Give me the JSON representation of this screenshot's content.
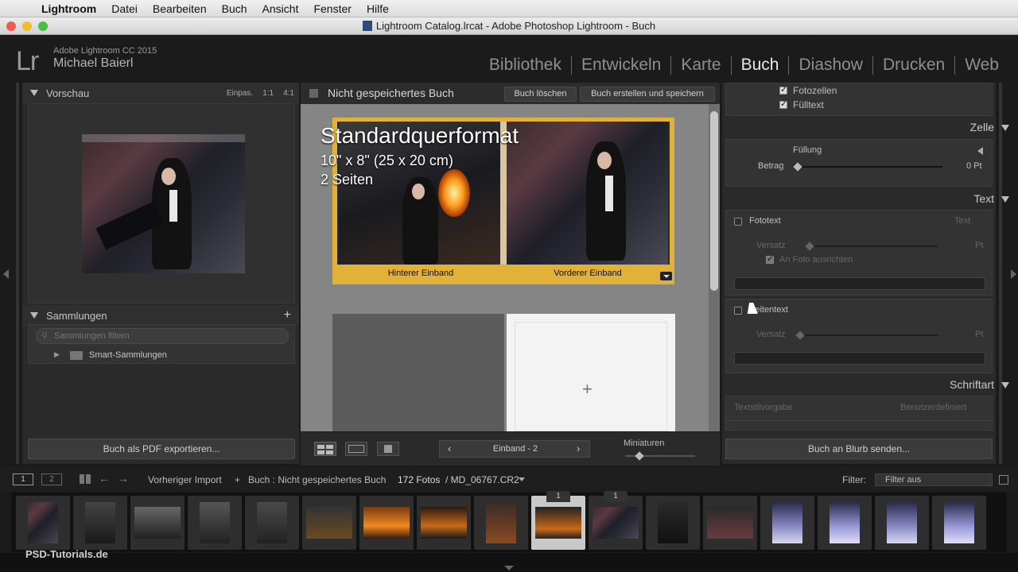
{
  "menubar": {
    "app": "Lightroom",
    "items": [
      "Datei",
      "Bearbeiten",
      "Buch",
      "Ansicht",
      "Fenster",
      "Hilfe"
    ]
  },
  "window": {
    "title": "Lightroom Catalog.lrcat - Adobe Photoshop Lightroom - Buch"
  },
  "identity": {
    "logo": "Lr",
    "version": "Adobe Lightroom CC 2015",
    "user": "Michael Baierl"
  },
  "modules": [
    {
      "label": "Bibliothek"
    },
    {
      "label": "Entwickeln"
    },
    {
      "label": "Karte"
    },
    {
      "label": "Buch"
    },
    {
      "label": "Diashow"
    },
    {
      "label": "Drucken"
    },
    {
      "label": "Web"
    }
  ],
  "active_module": "Buch",
  "left": {
    "preview": {
      "title": "Vorschau",
      "zoom": [
        "Einpas.",
        "1:1",
        "4:1"
      ]
    },
    "collections": {
      "title": "Sammlungen",
      "search_placeholder": "Sammlungen filtern",
      "smart": "Smart-Sammlungen"
    },
    "export_button": "Buch als PDF exportieren..."
  },
  "center": {
    "book_title": "Nicht gespeichertes Buch",
    "delete_button": "Buch löschen",
    "create_button": "Buch erstellen und speichern",
    "format_title": "Standardquerformat",
    "format_size": "10\" x 8\" (25 x 20 cm)",
    "format_pages": "2 Seiten",
    "back_cover": "Hinterer Einband",
    "front_cover": "Vorderer Einband",
    "page_nav": "Einband - 2",
    "thumbs_label": "Miniaturen"
  },
  "right": {
    "checks": [
      {
        "label": "Fotozellen",
        "checked": true
      },
      {
        "label": "Fülltext",
        "checked": true
      }
    ],
    "cell": {
      "header": "Zelle",
      "padding_label": "Füllung",
      "amount_label": "Betrag",
      "amount_value": "0 Pt"
    },
    "text": {
      "header": "Text",
      "photo_text": "Fototext",
      "photo_text_mode": "Text",
      "offset_label": "Versatz",
      "align_label": "An Foto ausrichten",
      "page_text": "Seitentext",
      "unit": "Pt"
    },
    "font": {
      "header": "Schriftart",
      "preset_label": "Textstilvorgabe",
      "preset_value": "Benutzerdefiniert"
    },
    "blurb_button": "Buch an Blurb senden..."
  },
  "filmbar": {
    "screen1": "1",
    "screen2": "2",
    "source": "Vorheriger Import",
    "plus": "+",
    "book": "Buch : Nicht gespeichertes Buch",
    "count": "172 Fotos",
    "file": "/ MD_06767.CR2",
    "filter_label": "Filter:",
    "filter_value": "Filter aus"
  },
  "filmstrip": {
    "badges": [
      "1",
      "1"
    ]
  },
  "watermark": "PSD-Tutorials.de"
}
